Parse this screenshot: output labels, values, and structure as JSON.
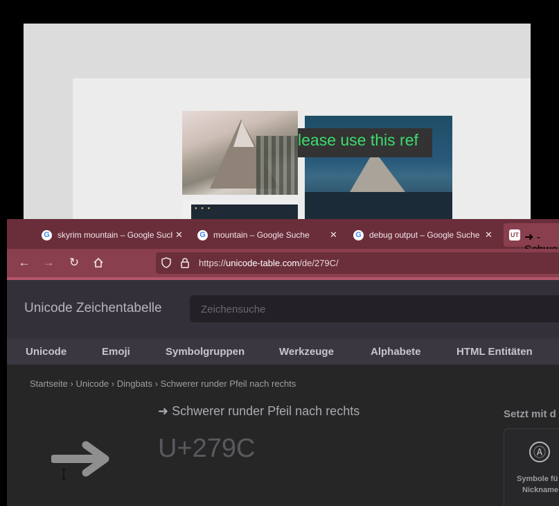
{
  "background": {
    "caption": "lease use this ref"
  },
  "browser": {
    "tabs": [
      {
        "label": "skyrim mountain – Google Suche"
      },
      {
        "label": "mountain – Google Suche"
      },
      {
        "label": "debug output – Google Suche"
      },
      {
        "label": "➜ - Schwe"
      }
    ],
    "active_tab_icon": "UT",
    "url": {
      "prefix": "https://",
      "domain": "unicode-table.com",
      "path": "/de/279C/"
    }
  },
  "site": {
    "title": "Unicode Zeichentabelle",
    "search_placeholder": "Zeichensuche",
    "menu": [
      "Unicode",
      "Emoji",
      "Symbolgruppen",
      "Werkzeuge",
      "Alphabete",
      "HTML Entitäten"
    ],
    "breadcrumb": "Startseite › Unicode › Dingbats › Schwerer runder Pfeil nach rechts",
    "char_heading": "➜ Schwerer runder Pfeil nach rechts",
    "codepoint": "U+279C",
    "side_heading": "Setzt mit d",
    "side_card": {
      "icon": "Ⓐ",
      "label_line1": "Symbole fü",
      "label_line2": "Nickname"
    }
  },
  "colors": {
    "tabbar": "#6a2d3a",
    "navbar": "#8a3f4e",
    "caption_text": "#3ddc6e"
  }
}
